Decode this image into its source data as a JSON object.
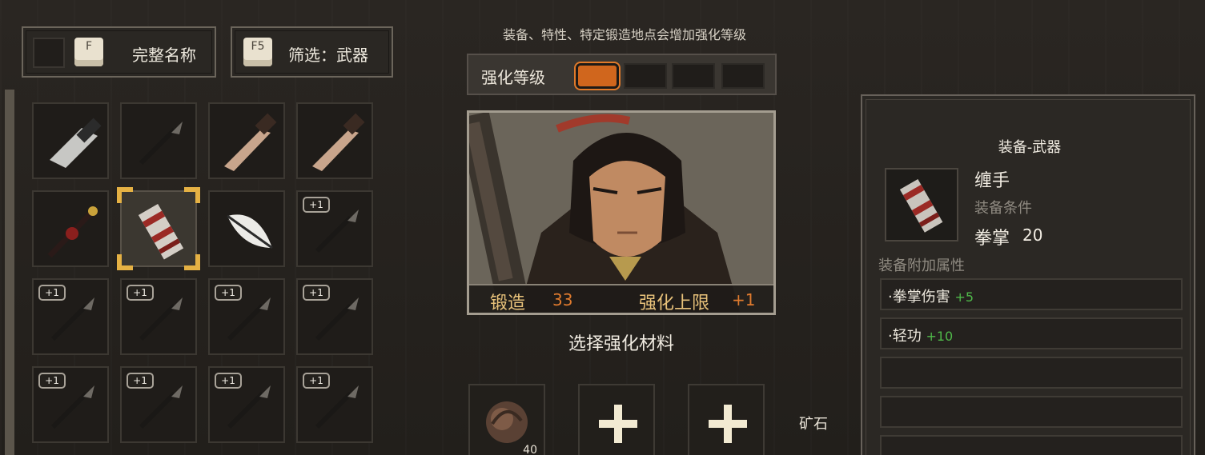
{
  "left_panel": {
    "name_button": {
      "key": "F",
      "label": "完整名称"
    },
    "filter_button": {
      "key": "F5",
      "label": "筛选：武器"
    },
    "inventory": [
      {
        "icon": "cleaver-icon",
        "badge": ""
      },
      {
        "icon": "dagger-icon",
        "badge": ""
      },
      {
        "icon": "wooden-sword-icon",
        "badge": ""
      },
      {
        "icon": "wooden-sword-icon",
        "badge": ""
      },
      {
        "icon": "bloody-staff-icon",
        "badge": ""
      },
      {
        "icon": "hand-wraps-icon",
        "badge": "",
        "selected": true
      },
      {
        "icon": "leaf-blade-icon",
        "badge": ""
      },
      {
        "icon": "dagger-icon",
        "badge": "+1"
      },
      {
        "icon": "dagger-icon",
        "badge": "+1"
      },
      {
        "icon": "dagger-icon",
        "badge": "+1"
      },
      {
        "icon": "dagger-icon",
        "badge": "+1"
      },
      {
        "icon": "dagger-icon",
        "badge": "+1"
      },
      {
        "icon": "dagger-icon",
        "badge": "+1"
      },
      {
        "icon": "dagger-icon",
        "badge": "+1"
      },
      {
        "icon": "dagger-icon",
        "badge": "+1"
      },
      {
        "icon": "dagger-icon",
        "badge": "+1"
      }
    ]
  },
  "center": {
    "hint": "装备、特性、特定锻造地点会增加强化等级",
    "level_label": "强化等级",
    "level_current": 1,
    "level_max": 4,
    "forge_label": "锻造",
    "forge_value": "33",
    "cap_label": "强化上限",
    "cap_value": "+1",
    "select_material": "选择强化材料",
    "material_qty": "40",
    "ore_label": "矿石"
  },
  "info": {
    "title": "装备-武器",
    "name": "缠手",
    "requirement": "装备条件",
    "stat_name": "拳掌",
    "stat_value": "20",
    "attr_title": "装备附加属性",
    "attrs": [
      {
        "name": "·拳掌伤害",
        "value": "+5"
      },
      {
        "name": "·轻功",
        "value": "+10"
      }
    ]
  },
  "colors": {
    "accent_orange": "#d0661d",
    "bonus_green": "#4fb84a",
    "gold": "#e5b144"
  }
}
